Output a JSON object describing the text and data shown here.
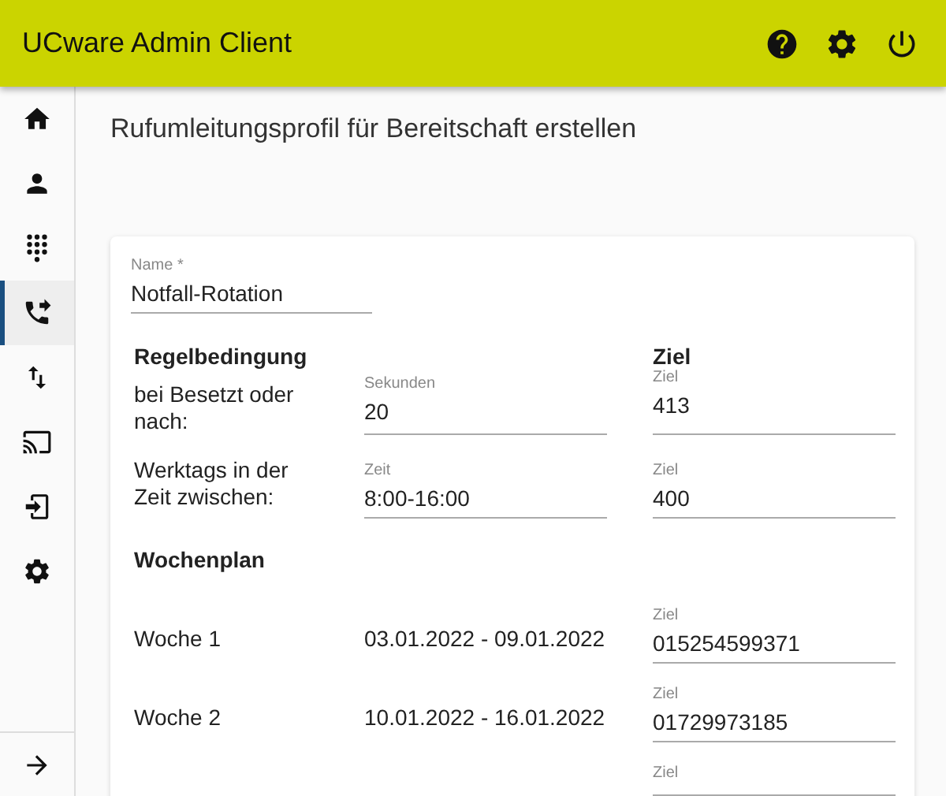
{
  "app_bar": {
    "title": "UCware Admin Client",
    "actions": [
      {
        "kind": "help"
      },
      {
        "kind": "settings"
      },
      {
        "kind": "power"
      }
    ]
  },
  "sidebar": {
    "items": [
      {
        "kind": "home",
        "selected": false
      },
      {
        "kind": "person",
        "selected": false
      },
      {
        "kind": "dialpad",
        "selected": false
      },
      {
        "kind": "forward",
        "selected": true
      },
      {
        "kind": "swap",
        "selected": false
      },
      {
        "kind": "cast",
        "selected": false
      },
      {
        "kind": "login",
        "selected": false
      },
      {
        "kind": "settings",
        "selected": false
      }
    ],
    "footer_item": {
      "kind": "arrow"
    }
  },
  "page_title": "Rufumleitungsprofil für Bereitschaft erstellen",
  "form": {
    "name_field": {
      "label": "Name *",
      "value": "Notfall-Rotation"
    },
    "condition_heading": "Regelbedingung",
    "target_heading": "Ziel",
    "rules": [
      {
        "label": "bei Besetzt oder nach:",
        "field": {
          "label": "Sekunden",
          "value": "20"
        },
        "target": {
          "label": "Ziel",
          "value": "413"
        }
      },
      {
        "label": "Werktags in der Zeit zwischen:",
        "field": {
          "label": "Zeit",
          "value": "8:00-16:00"
        },
        "target": {
          "label": "Ziel",
          "value": "400"
        }
      }
    ],
    "schedule_heading": "Wochenplan",
    "weeks": [
      {
        "label": "Woche 1",
        "range": "03.01.2022 - 09.01.2022",
        "target": {
          "label": "Ziel",
          "value": "015254599371"
        }
      },
      {
        "label": "Woche 2",
        "range": "10.01.2022 - 16.01.2022",
        "target": {
          "label": "Ziel",
          "value": "01729973185"
        }
      },
      {
        "target": {
          "label": "Ziel"
        }
      }
    ]
  }
}
